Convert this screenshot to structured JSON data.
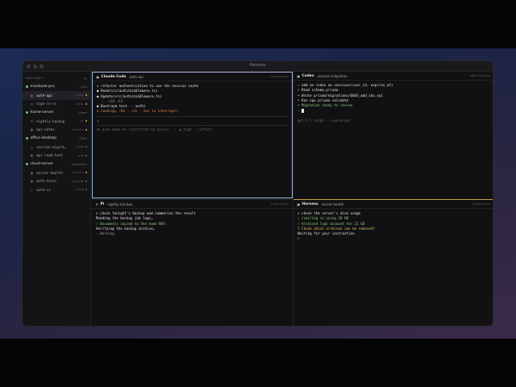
{
  "app": {
    "title": "Harness"
  },
  "sidebar": {
    "header": "MACHINES",
    "add_label": "+",
    "machines": [
      {
        "name": "macbook-pro",
        "location": "Local",
        "dot": "#6cc070",
        "sessions": [
          {
            "name": "auth-api",
            "status": "claude",
            "dot": "#e0a040",
            "active": true,
            "icon": "terminal-icon"
          },
          {
            "name": "sign-in-ui",
            "status": "codex",
            "dot": "#e0a040",
            "active": false,
            "icon": "codex-icon"
          }
        ]
      },
      {
        "name": "home-server",
        "location": "Home",
        "dot": "#6cc070",
        "sessions": [
          {
            "name": "nightly-backup",
            "status": "pi",
            "dot": "#e0a040",
            "active": false,
            "icon": "pi-icon"
          },
          {
            "name": "api-notes",
            "status": "harness",
            "dot": "#e0a040",
            "active": false,
            "icon": "terminal-icon"
          }
        ]
      },
      {
        "name": "office-desktop",
        "location": "Office",
        "dot": "#6cc070",
        "sessions": [
          {
            "name": "session-migrat…",
            "status": "codex",
            "dot": "#6a6a70",
            "active": false,
            "icon": "codex-icon"
          },
          {
            "name": "api-load-test",
            "status": "grok",
            "dot": "#6a6a70",
            "active": false,
            "icon": "terminal-icon"
          }
        ]
      },
      {
        "name": "cloud-server",
        "location": "Datacenter",
        "dot": "#6cc070",
        "sessions": [
          {
            "name": "server-health",
            "status": "harness",
            "dot": "#e0a040",
            "active": false,
            "icon": "terminal-icon"
          },
          {
            "name": "auth-tests",
            "status": "opencode",
            "dot": "#6a6a70",
            "active": false,
            "icon": "terminal-icon"
          },
          {
            "name": "auth-ci",
            "status": "droid",
            "dot": "#6a6a70",
            "active": false,
            "icon": "droid-icon"
          }
        ]
      }
    ]
  },
  "panes": {
    "tl": {
      "agent": "Claude Code",
      "session": "auth-api",
      "host": "macbook-pro",
      "lines": [
        {
          "t": "> refactor authentication to use the session cache",
          "c": "c-white"
        },
        {
          "t": "● Read(src/auth/middleware.ts)",
          "c": "c-white"
        },
        {
          "t": "● Update(src/auth/middleware.ts)",
          "c": "c-white"
        },
        {
          "t": "  ⎿  +18 −23",
          "c": "c-gray"
        },
        {
          "t": "● Bash(npm test -- auth)",
          "c": "c-white"
        },
        {
          "t": "✻ Cooking… (8s · ↑2s · esc to interrupt)",
          "c": "c-orange"
        }
      ],
      "prompt": ">",
      "footer": "⏵⏵ plan mode on (shift+tab to cycle)  ·  ◐ high · /effort"
    },
    "tr": {
      "agent": "Codex",
      "session": "session-migration",
      "host": "office-desktop",
      "lines": [
        {
          "t": "› add an index on sessions(user_id, expires_at)",
          "c": "c-white"
        },
        {
          "t": "• Read schema.prisma",
          "c": "c-white"
        },
        {
          "t": "• Wrote prisma/migrations/0043_add_idx.sql",
          "c": "c-white"
        },
        {
          "t": "• Ran npx prisma validate",
          "c": "c-white"
        },
        {
          "t": "• Migration ready to review",
          "c": "c-green"
        }
      ],
      "prompt": "›",
      "footer": "gpt-5.5 xhigh · ~/work/api"
    },
    "bl": {
      "agent": "Pi",
      "session": "nightly-backup",
      "host": "home-server",
      "lines": [
        {
          "t": "> check tonight's backup and summarize the result",
          "c": "c-white"
        },
        {
          "t": "Reading the backup job logs…",
          "c": "c-white"
        },
        {
          "t": "✓ Documents copied to the home NAS",
          "c": "c-green"
        },
        {
          "t": "Verifying the backup archive…",
          "c": "c-white"
        },
        {
          "t": "· Working",
          "c": "c-gray"
        }
      ]
    },
    "br": {
      "agent": "Harness",
      "session": "server-health",
      "host": "cloud-server",
      "lines": [
        {
          "t": "> check the server's disk usage",
          "c": "c-white"
        },
        {
          "t": "✓ /var/log is using 28 GB",
          "c": "c-green"
        },
        {
          "t": "✓ Archived logs account for 21 GB",
          "c": "c-green"
        },
        {
          "t": "? Check which archives can be removed?",
          "c": "c-yellow"
        },
        {
          "t": "Waiting for your instruction",
          "c": "c-white"
        }
      ],
      "prompt": ">"
    }
  }
}
